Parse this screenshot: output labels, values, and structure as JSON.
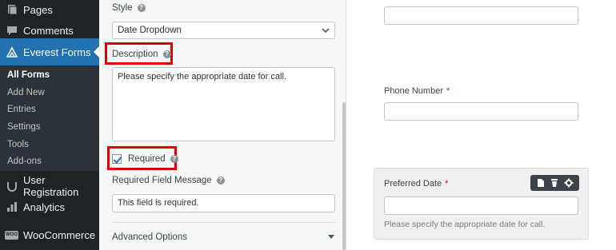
{
  "sidebar": {
    "top_items": [
      {
        "label": "Pages",
        "icon": "pages-icon"
      },
      {
        "label": "Comments",
        "icon": "comments-icon"
      }
    ],
    "active_item": {
      "label": "Everest Forms",
      "icon": "everest-forms-icon"
    },
    "submenu": [
      {
        "label": "All Forms",
        "current": true
      },
      {
        "label": "Add New"
      },
      {
        "label": "Entries"
      },
      {
        "label": "Settings"
      },
      {
        "label": "Tools"
      },
      {
        "label": "Add-ons"
      }
    ],
    "bottom_items": [
      {
        "label": "User Registration",
        "icon": "user-registration-icon"
      },
      {
        "label": "Analytics",
        "icon": "analytics-icon"
      },
      {
        "label": "WooCommerce",
        "icon": "woocommerce-icon",
        "badge": "WOO"
      }
    ]
  },
  "options": {
    "style_label": "Style",
    "style_value": "Date Dropdown",
    "description_label": "Description",
    "description_value": "Please specify the appropriate date for call.",
    "required_label": "Required",
    "required_checked": true,
    "required_message_label": "Required Field Message",
    "required_message_value": "This field is required.",
    "advanced_label": "Advanced Options"
  },
  "preview": {
    "phone_label": "Phone Number",
    "required_mark": "*",
    "date_label": "Preferred Date",
    "date_description": "Please specify the appropriate date for call."
  },
  "colors": {
    "sidebar_bg": "#1d2327",
    "active_bg": "#2271b1",
    "highlight": "#e00000"
  }
}
